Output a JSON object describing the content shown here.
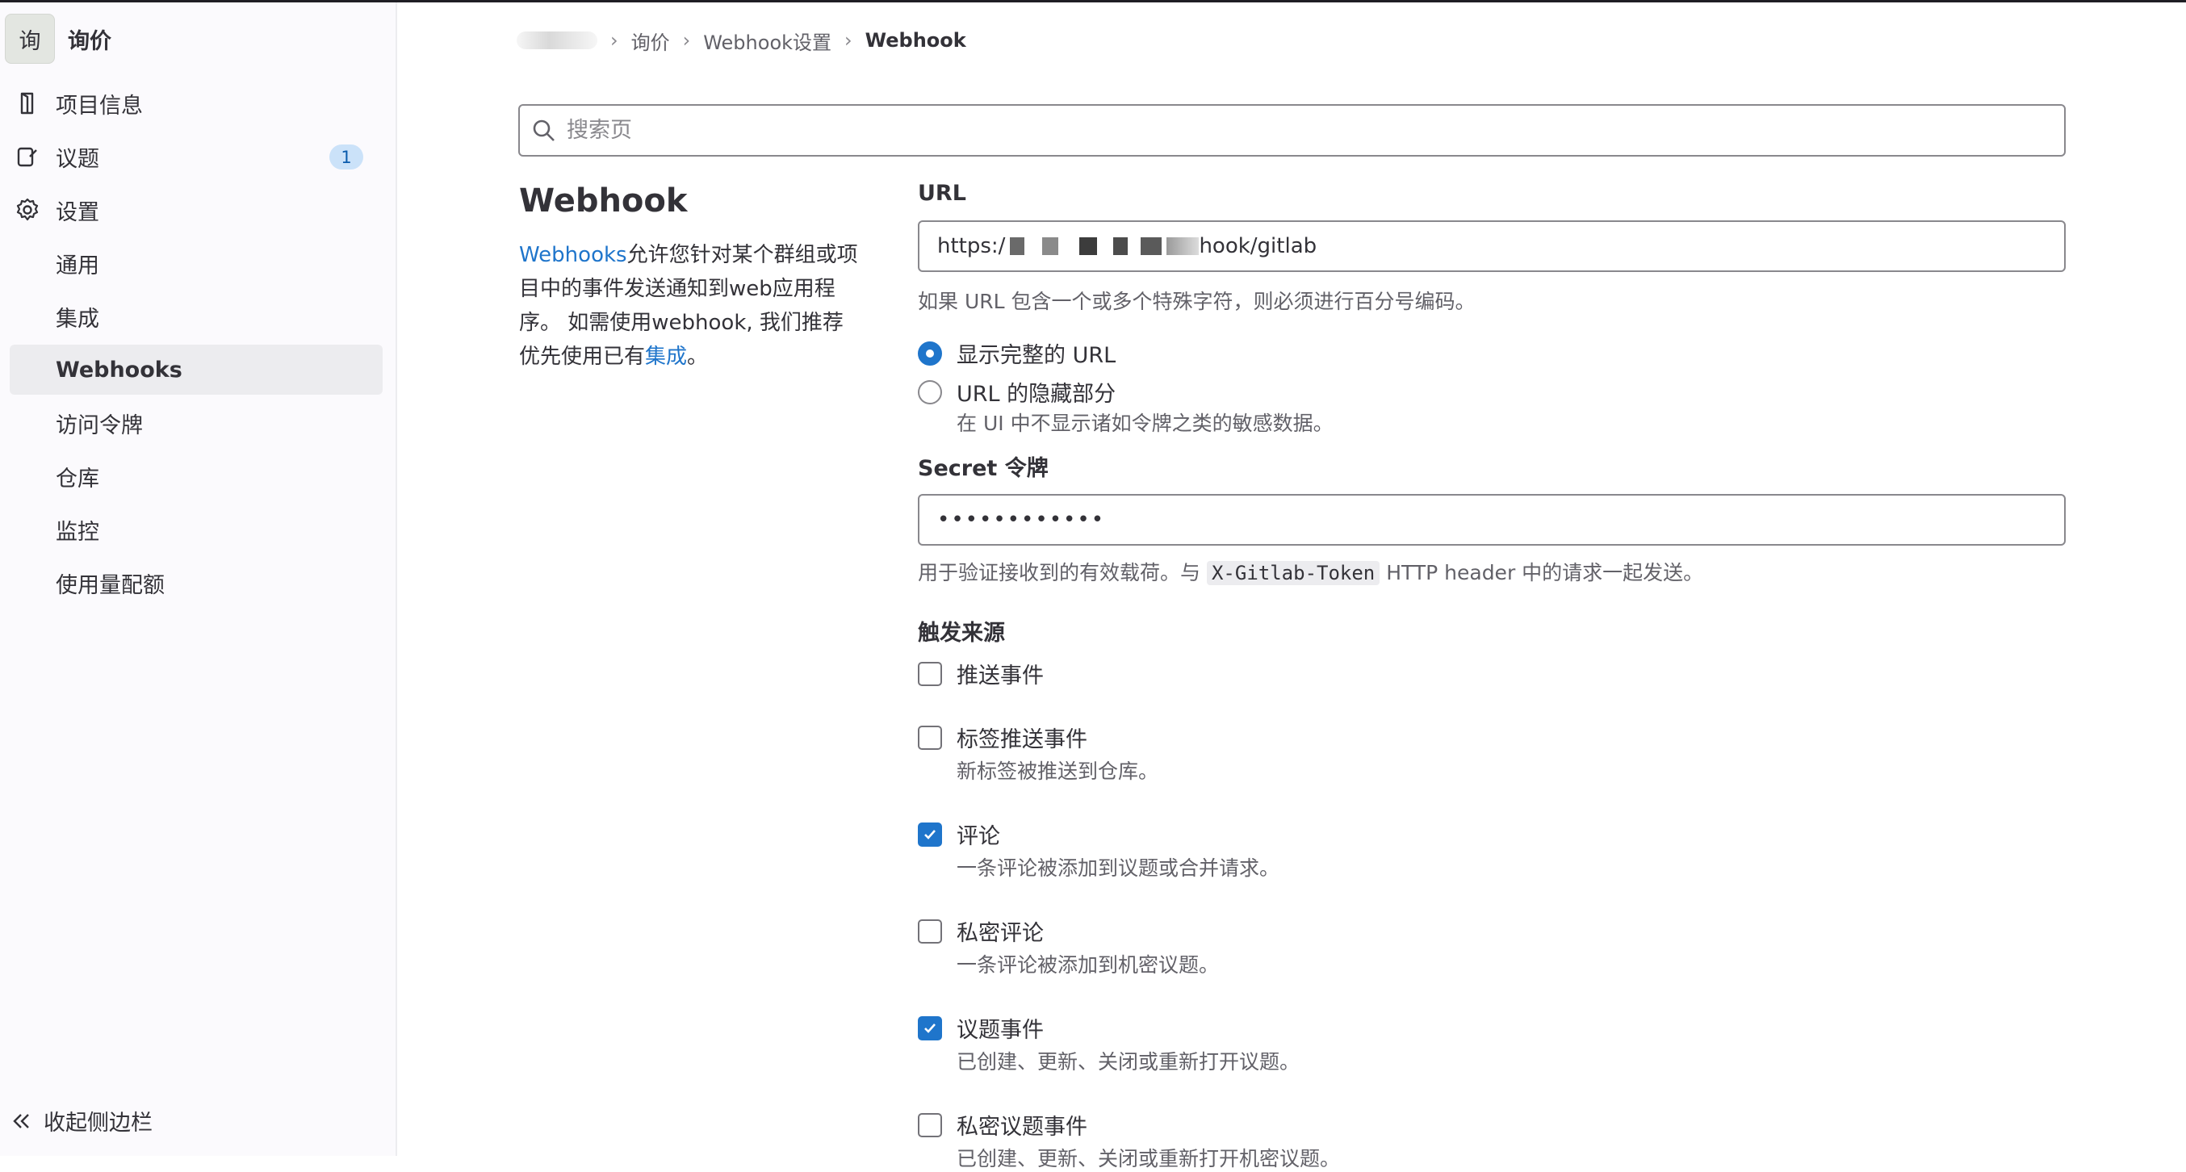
{
  "project": {
    "avatar": "询",
    "name": "询价"
  },
  "sidebar": {
    "items": [
      {
        "label": "项目信息",
        "icon": "project-info-icon"
      },
      {
        "label": "议题",
        "icon": "issues-icon",
        "badge": "1"
      },
      {
        "label": "设置",
        "icon": "gear-icon"
      }
    ],
    "settings_sub": [
      "通用",
      "集成",
      "Webhooks",
      "访问令牌",
      "仓库",
      "监控",
      "使用量配额"
    ],
    "active": "Webhooks",
    "collapse_label": "收起侧边栏"
  },
  "breadcrumb": [
    "询价",
    "Webhook设置",
    "Webhook"
  ],
  "search": {
    "placeholder": "搜索页"
  },
  "page": {
    "title": "Webhook",
    "desc_link": "Webhooks",
    "desc_text": "允许您针对某个群组或项目中的事件发送通知到web应用程序。 如需使用webhook, 我们推荐优先使用已有",
    "desc_link2": "集成",
    "desc_end": "。"
  },
  "form": {
    "url_label": "URL",
    "url_prefix": "https:/",
    "url_suffix": "hook/gitlab",
    "url_help": "如果 URL 包含一个或多个特殊字符，则必须进行百分号编码。",
    "radio_full": "显示完整的 URL",
    "radio_mask": "URL 的隐藏部分",
    "radio_mask_help": "在 UI 中不显示诸如令牌之类的敏感数据。",
    "secret_label": "Secret 令牌",
    "secret_value": "••••••••••••",
    "secret_help_pre": "用于验证接收到的有效载荷。与",
    "secret_help_code": "X-Gitlab-Token",
    "secret_help_post": "HTTP header 中的请求一起发送。",
    "triggers_label": "触发来源",
    "triggers": [
      {
        "label": "推送事件",
        "checked": false,
        "help": ""
      },
      {
        "label": "标签推送事件",
        "checked": false,
        "help": "新标签被推送到仓库。"
      },
      {
        "label": "评论",
        "checked": true,
        "help": "一条评论被添加到议题或合并请求。"
      },
      {
        "label": "私密评论",
        "checked": false,
        "help": "一条评论被添加到机密议题。"
      },
      {
        "label": "议题事件",
        "checked": true,
        "help": "已创建、更新、关闭或重新打开议题。"
      },
      {
        "label": "私密议题事件",
        "checked": false,
        "help": "已创建、更新、关闭或重新打开机密议题。"
      }
    ]
  },
  "colors": {
    "accent": "#1f75cb",
    "sidebar_bg": "#fbfafd",
    "active_bg": "#ececef",
    "badge_bg": "#cbe2f9"
  }
}
